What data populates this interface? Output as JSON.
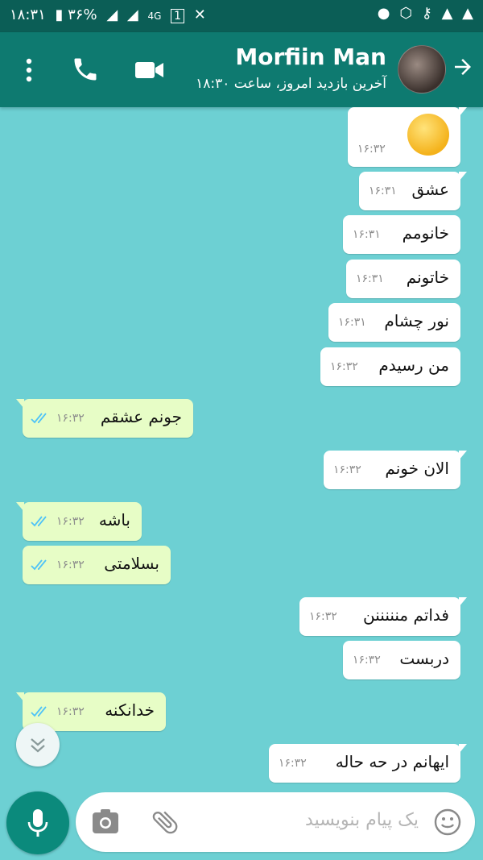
{
  "status_bar": {
    "time": "۱۸:۳۱",
    "battery": "۳۶%",
    "network": "4G",
    "sim": "1"
  },
  "header": {
    "contact_name": "Morfiin Man",
    "last_seen": "آخرین بازدید امروز، ساعت ۱۸:۳۰"
  },
  "messages": [
    {
      "dir": "in",
      "type": "emoji",
      "text": "",
      "time": "۱۶:۳۲"
    },
    {
      "dir": "in",
      "text": "عشق",
      "time": "۱۶:۳۱"
    },
    {
      "dir": "in",
      "text": "خانومم",
      "time": "۱۶:۳۱"
    },
    {
      "dir": "in",
      "text": "خاتونم",
      "time": "۱۶:۳۱"
    },
    {
      "dir": "in",
      "text": "نور چشام",
      "time": "۱۶:۳۱"
    },
    {
      "dir": "in",
      "text": "من رسیدم",
      "time": "۱۶:۳۲"
    },
    {
      "dir": "out",
      "text": "جونم عشقم",
      "time": "۱۶:۳۲"
    },
    {
      "dir": "in",
      "text": "الان خونم",
      "time": "۱۶:۳۲"
    },
    {
      "dir": "out",
      "text": "باشه",
      "time": "۱۶:۳۲"
    },
    {
      "dir": "out",
      "text": "بسلامتی",
      "time": "۱۶:۳۲"
    },
    {
      "dir": "in",
      "text": "فداتم منننننن",
      "time": "۱۶:۳۲"
    },
    {
      "dir": "in",
      "text": "دربست",
      "time": "۱۶:۳۲"
    },
    {
      "dir": "out",
      "text": "خدانکنه",
      "time": "۱۶:۳۲"
    },
    {
      "dir": "in",
      "text": "ایهانم در حه حاله",
      "time": "۱۶:۳۲"
    }
  ],
  "composer": {
    "placeholder": "یک پیام بنویسید"
  },
  "colors": {
    "status_bar": "#0b5e56",
    "app_bar": "#0e7a70",
    "chat_background": "#6dd0d3",
    "incoming_bubble": "#ffffff",
    "outgoing_bubble": "#e7fdc6",
    "read_ticks": "#4fc3f7",
    "mic_button": "#0b8a7c"
  },
  "icons": {
    "back": "arrow-right-icon",
    "video": "video-camera-icon",
    "call": "phone-icon",
    "more": "more-vertical-icon",
    "scroll": "double-chevron-down-icon",
    "emoji": "smiley-icon",
    "attach": "paperclip-icon",
    "camera": "camera-icon",
    "mic": "microphone-icon"
  }
}
